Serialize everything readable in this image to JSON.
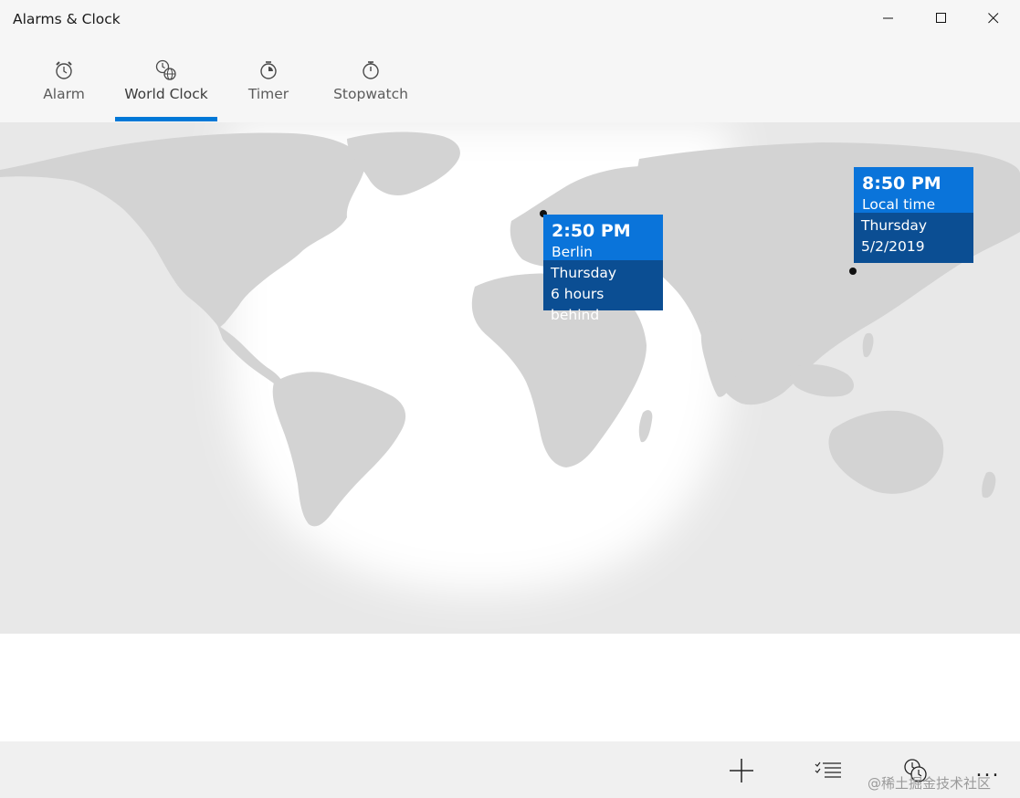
{
  "window": {
    "title": "Alarms & Clock",
    "controls": {
      "minimize": "minimize",
      "maximize": "maximize",
      "close": "close"
    }
  },
  "tabs": [
    {
      "label": "Alarm",
      "icon": "alarm-clock-icon",
      "active": false
    },
    {
      "label": "World Clock",
      "icon": "world-clock-icon",
      "active": true
    },
    {
      "label": "Timer",
      "icon": "timer-icon",
      "active": false
    },
    {
      "label": "Stopwatch",
      "icon": "stopwatch-icon",
      "active": false
    }
  ],
  "clocks": [
    {
      "time": "2:50 PM",
      "place": "Berlin",
      "day": "Thursday",
      "detail": "6 hours behind"
    },
    {
      "time": "8:50 PM",
      "place": "Local time",
      "day": "Thursday",
      "detail": "5/2/2019"
    }
  ],
  "commands": [
    {
      "icon": "add-icon"
    },
    {
      "icon": "select-list-icon"
    },
    {
      "icon": "compare-clocks-icon"
    },
    {
      "icon": "more-icon",
      "label": "..."
    }
  ],
  "colors": {
    "accent": "#0078d7",
    "card_top": "#0a74da",
    "card_bottom": "#0b4e93",
    "land": "#d2d2d2",
    "night": "#e8e8e8"
  },
  "watermark": "@稀土掘金技术社区"
}
